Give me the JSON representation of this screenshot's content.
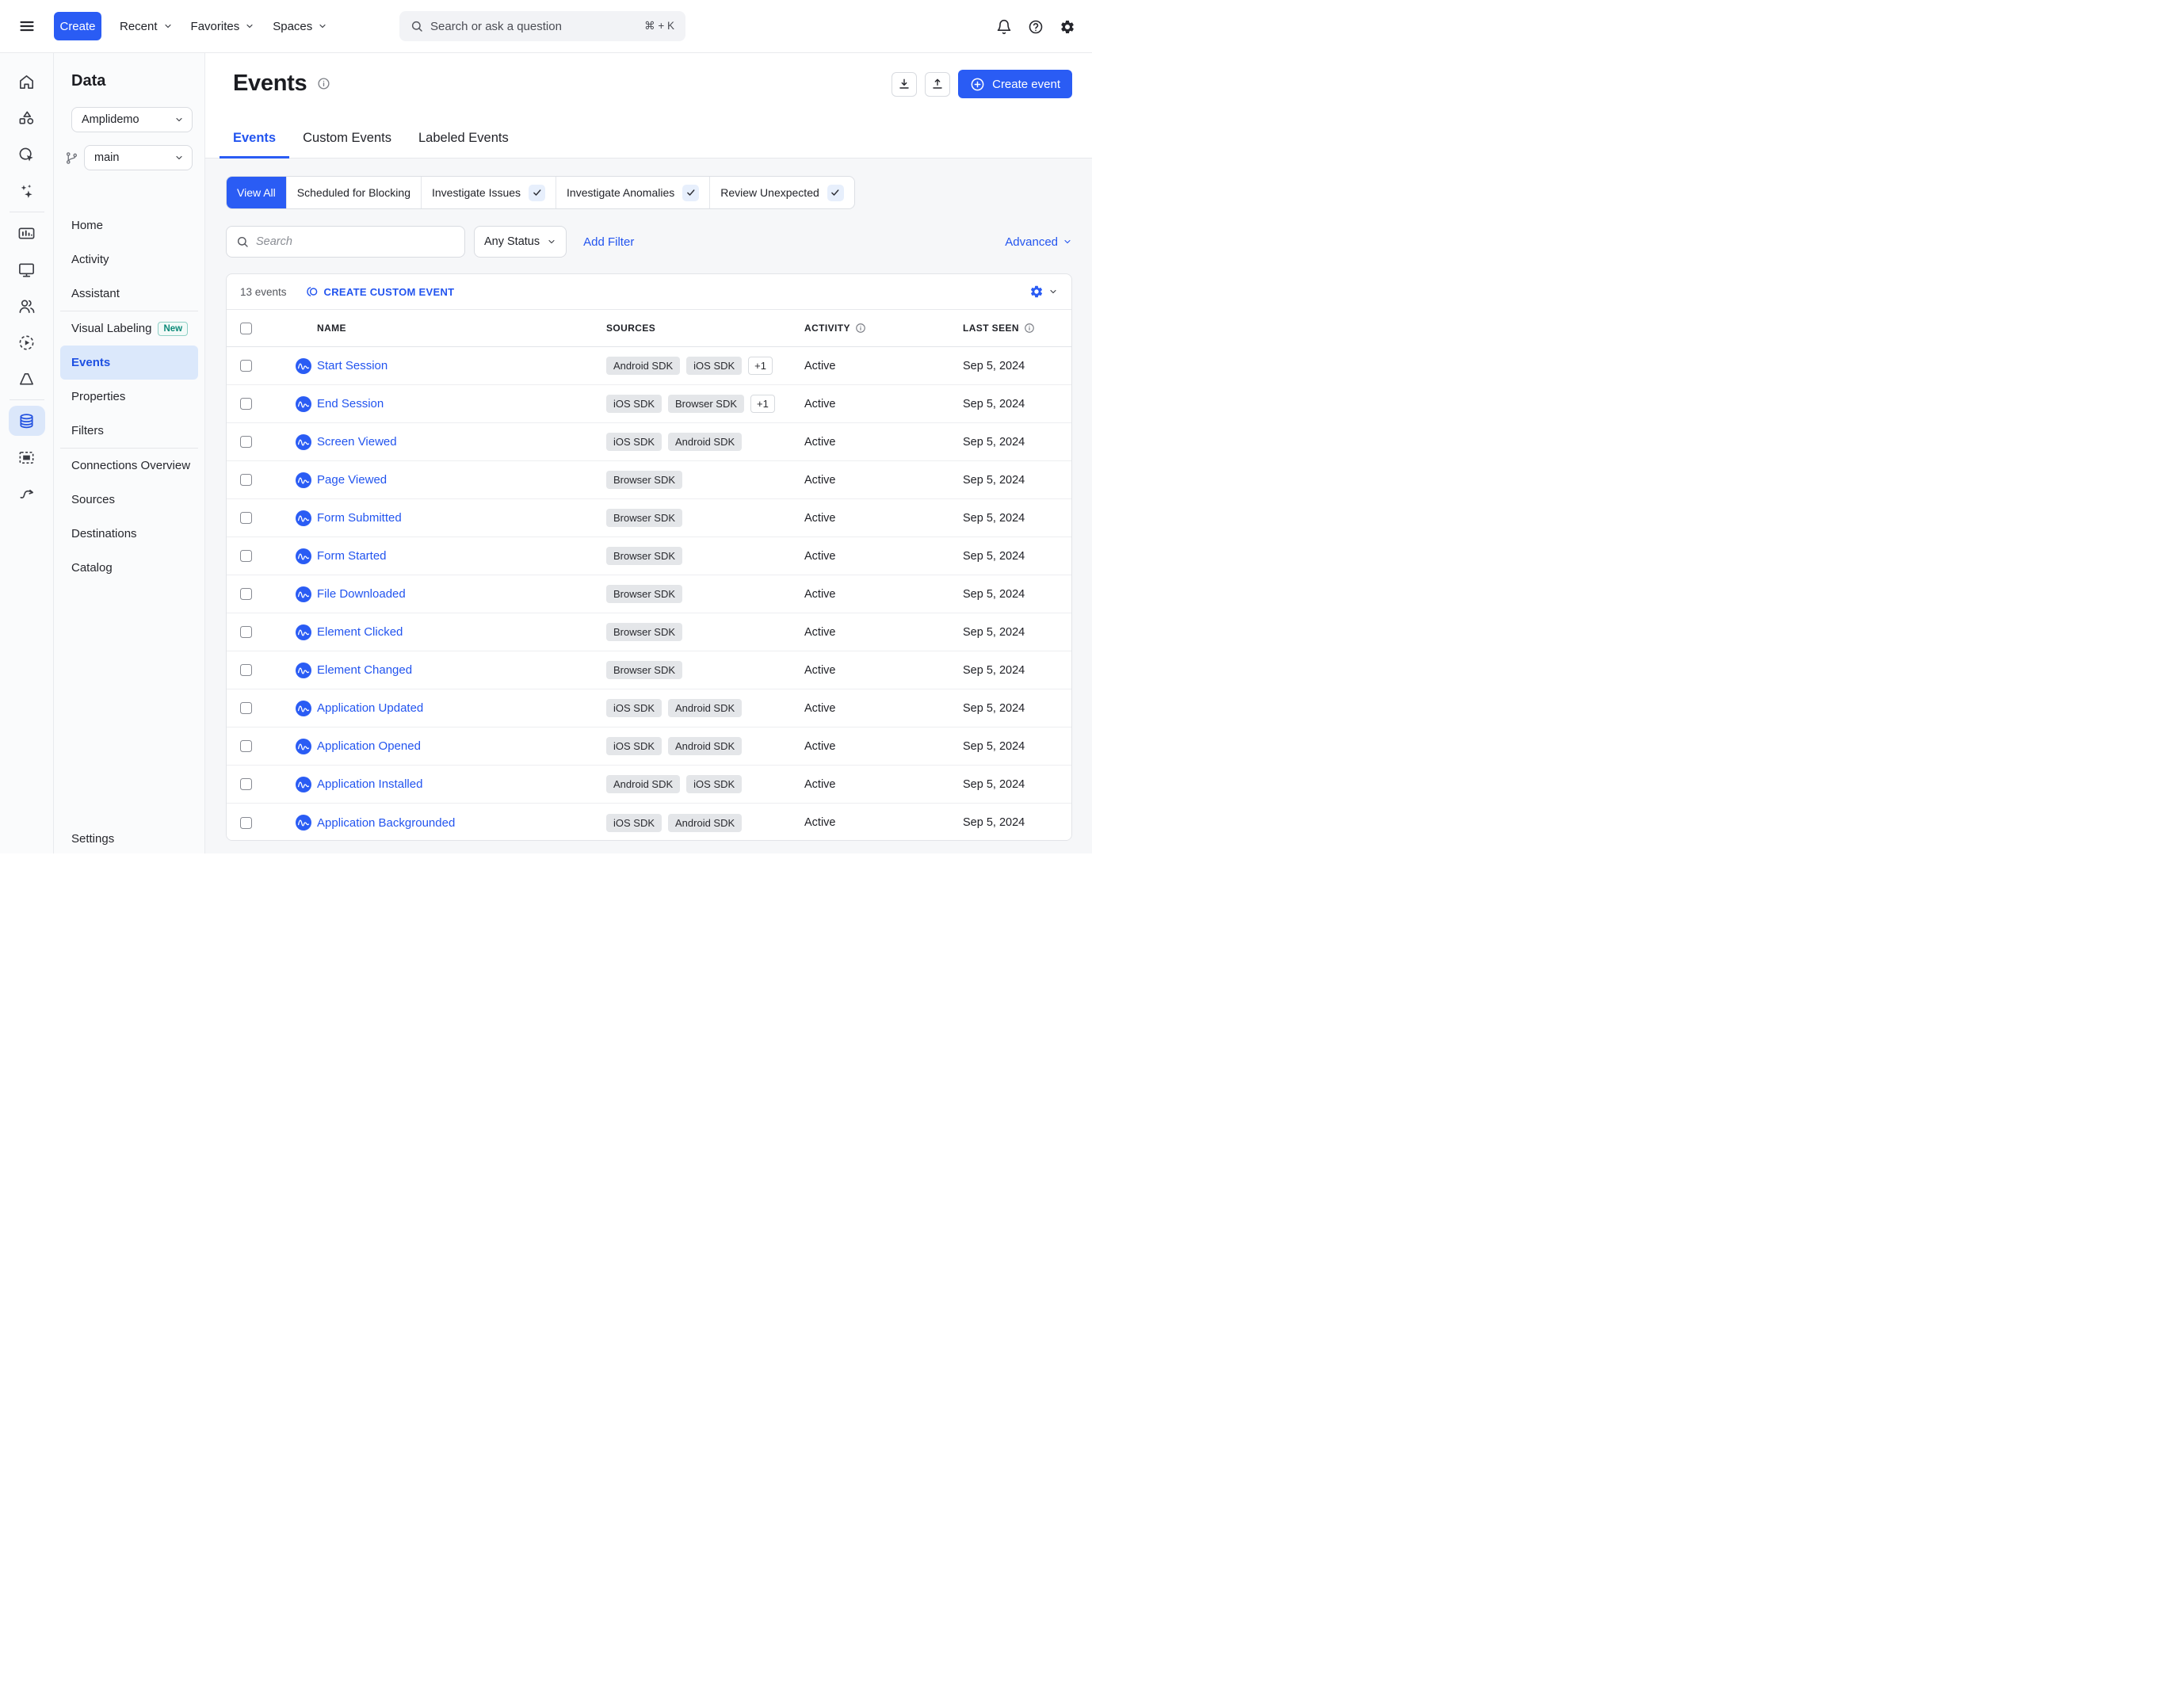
{
  "topbar": {
    "create_label": "Create",
    "menus": [
      {
        "label": "Recent"
      },
      {
        "label": "Favorites"
      },
      {
        "label": "Spaces"
      }
    ],
    "search_placeholder": "Search or ask a question",
    "search_shortcut": "⌘ + K"
  },
  "sidebar": {
    "title": "Data",
    "project": "Amplidemo",
    "branch": "main",
    "items": [
      {
        "label": "Home"
      },
      {
        "label": "Activity"
      },
      {
        "label": "Assistant"
      },
      {
        "label": "Visual Labeling",
        "badge": "New"
      },
      {
        "label": "Events",
        "active": true
      },
      {
        "label": "Properties"
      },
      {
        "label": "Filters"
      },
      {
        "label": "Connections Overview"
      },
      {
        "label": "Sources"
      },
      {
        "label": "Destinations"
      },
      {
        "label": "Catalog"
      }
    ],
    "settings_label": "Settings"
  },
  "page": {
    "title": "Events",
    "tabs": [
      {
        "label": "Events",
        "active": true
      },
      {
        "label": "Custom Events"
      },
      {
        "label": "Labeled Events"
      }
    ],
    "actions": {
      "create_event_label": "Create event"
    },
    "segments": [
      {
        "label": "View All",
        "active": true
      },
      {
        "label": "Scheduled for Blocking"
      },
      {
        "label": "Investigate Issues",
        "checked": true
      },
      {
        "label": "Investigate Anomalies",
        "checked": true
      },
      {
        "label": "Review Unexpected",
        "checked": true
      }
    ],
    "toolbar": {
      "search_placeholder": "Search",
      "status_filter": "Any Status",
      "add_filter_label": "Add Filter",
      "advanced_label": "Advanced"
    },
    "table": {
      "summary": "13 events",
      "create_custom_label": "CREATE CUSTOM EVENT",
      "columns": [
        "NAME",
        "SOURCES",
        "ACTIVITY",
        "LAST SEEN"
      ],
      "rows": [
        {
          "name": "Start Session",
          "sources": [
            "Android SDK",
            "iOS SDK"
          ],
          "extra": "+1",
          "activity": "Active",
          "last_seen": "Sep 5, 2024"
        },
        {
          "name": "End Session",
          "sources": [
            "iOS SDK",
            "Browser SDK"
          ],
          "extra": "+1",
          "activity": "Active",
          "last_seen": "Sep 5, 2024"
        },
        {
          "name": "Screen Viewed",
          "sources": [
            "iOS SDK",
            "Android SDK"
          ],
          "extra": null,
          "activity": "Active",
          "last_seen": "Sep 5, 2024"
        },
        {
          "name": "Page Viewed",
          "sources": [
            "Browser SDK"
          ],
          "extra": null,
          "activity": "Active",
          "last_seen": "Sep 5, 2024"
        },
        {
          "name": "Form Submitted",
          "sources": [
            "Browser SDK"
          ],
          "extra": null,
          "activity": "Active",
          "last_seen": "Sep 5, 2024"
        },
        {
          "name": "Form Started",
          "sources": [
            "Browser SDK"
          ],
          "extra": null,
          "activity": "Active",
          "last_seen": "Sep 5, 2024"
        },
        {
          "name": "File Downloaded",
          "sources": [
            "Browser SDK"
          ],
          "extra": null,
          "activity": "Active",
          "last_seen": "Sep 5, 2024"
        },
        {
          "name": "Element Clicked",
          "sources": [
            "Browser SDK"
          ],
          "extra": null,
          "activity": "Active",
          "last_seen": "Sep 5, 2024"
        },
        {
          "name": "Element Changed",
          "sources": [
            "Browser SDK"
          ],
          "extra": null,
          "activity": "Active",
          "last_seen": "Sep 5, 2024"
        },
        {
          "name": "Application Updated",
          "sources": [
            "iOS SDK",
            "Android SDK"
          ],
          "extra": null,
          "activity": "Active",
          "last_seen": "Sep 5, 2024"
        },
        {
          "name": "Application Opened",
          "sources": [
            "iOS SDK",
            "Android SDK"
          ],
          "extra": null,
          "activity": "Active",
          "last_seen": "Sep 5, 2024"
        },
        {
          "name": "Application Installed",
          "sources": [
            "Android SDK",
            "iOS SDK"
          ],
          "extra": null,
          "activity": "Active",
          "last_seen": "Sep 5, 2024"
        },
        {
          "name": "Application Backgrounded",
          "sources": [
            "iOS SDK",
            "Android SDK"
          ],
          "extra": null,
          "activity": "Active",
          "last_seen": "Sep 5, 2024"
        }
      ]
    }
  },
  "colors": {
    "accent": "#2a5cf4",
    "link": "#2254ef",
    "new_badge_teal": "#0c8a79"
  }
}
